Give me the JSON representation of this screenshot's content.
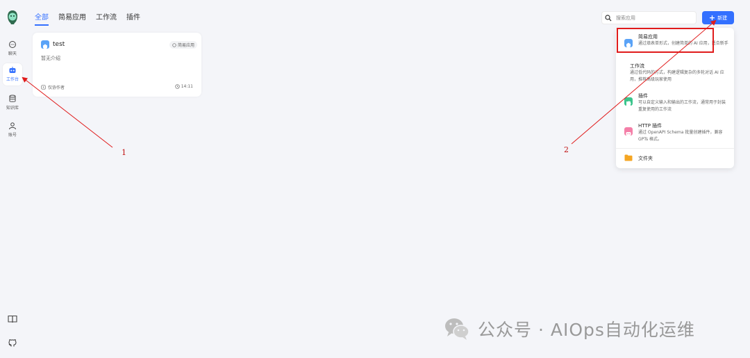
{
  "sidebar": {
    "items": [
      {
        "label": "聊天",
        "icon": "chat-icon"
      },
      {
        "label": "工作台",
        "icon": "robot-icon",
        "active": true
      },
      {
        "label": "知识库",
        "icon": "database-icon"
      },
      {
        "label": "账号",
        "icon": "user-icon"
      }
    ],
    "bottom_icons": [
      "book-icon",
      "github-icon"
    ]
  },
  "tabs": [
    {
      "label": "全部",
      "active": true
    },
    {
      "label": "简易应用"
    },
    {
      "label": "工作流"
    },
    {
      "label": "插件"
    }
  ],
  "search": {
    "placeholder": "搜索应用"
  },
  "new_button": {
    "label": "新建",
    "plus": "+"
  },
  "card": {
    "title": "test",
    "badge": "简易应用",
    "description": "暂无介绍",
    "author": "仅协作者",
    "time": "14:11"
  },
  "dropdown": {
    "items": [
      {
        "title": "简易应用",
        "desc": "通过填表单形式，创建简单的 AI 应用，适合新手",
        "icon": "simple-app-icon",
        "color": "#5aa3f7"
      },
      {
        "title": "工作流",
        "desc": "通过低代码的方式，构建逻辑复杂的多轮对话 AI 应用，推荐高级玩家使用",
        "icon": "",
        "color": ""
      },
      {
        "title": "插件",
        "desc": "可以自定义输入和输出的工作流，通常用于封装重复使用的工作流",
        "icon": "plugin-icon",
        "color": "#3bc48c"
      },
      {
        "title": "HTTP 插件",
        "desc": "通过 OpenAPI Schema 批量创建插件，兼容 GPTs 格式。",
        "icon": "http-plugin-icon",
        "color": "#f47fa8"
      }
    ],
    "folder": {
      "label": "文件夹",
      "color": "#f5a623"
    }
  },
  "annotations": {
    "label1": "1",
    "label2": "2",
    "color": "#e01b1b"
  },
  "watermark": {
    "text": "公众号 · AIOps自动化运维"
  }
}
